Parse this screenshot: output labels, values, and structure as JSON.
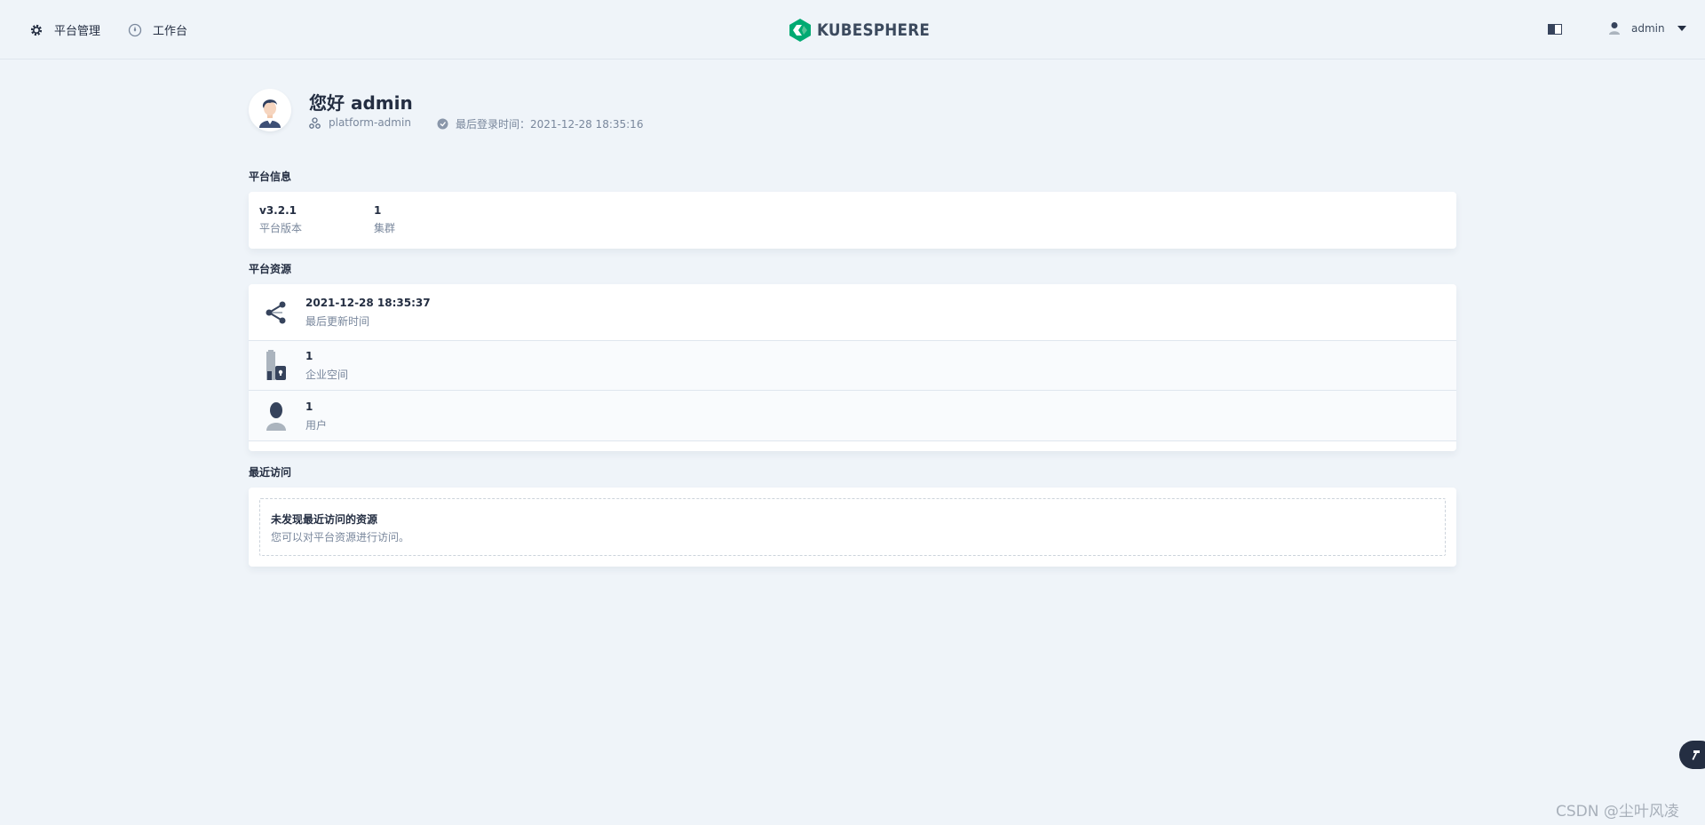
{
  "nav": {
    "platform_label": "平台管理",
    "platform_icon": "gear-icon",
    "workbench_label": "工作台",
    "workbench_icon": "compass-icon"
  },
  "brand": {
    "logo_text": "KUBESPHERE",
    "logo_color": "#00aa72"
  },
  "user": {
    "name": "admin"
  },
  "profile": {
    "greeting": "您好 admin",
    "role": "platform-admin",
    "last_login": "最后登录时间：2021-12-28 18:35:16"
  },
  "platform_info": {
    "title": "平台信息",
    "items": [
      {
        "value": "v3.2.1",
        "label": "平台版本"
      },
      {
        "value": "1",
        "label": "集群"
      }
    ]
  },
  "platform_resources": {
    "title": "平台资源",
    "items": [
      {
        "value": "2021-12-28 18:35:37",
        "label": "最后更新时间",
        "icon": "share-nodes-icon"
      },
      {
        "value": "1",
        "label": "企业空间",
        "icon": "enterprise-icon"
      },
      {
        "value": "1",
        "label": "用户",
        "icon": "user-icon"
      }
    ]
  },
  "recent": {
    "title": "最近访问",
    "empty_title": "未发现最近访问的资源",
    "empty_desc": "您可以对平台资源进行访问。"
  },
  "watermark": "CSDN @尘叶风凌"
}
